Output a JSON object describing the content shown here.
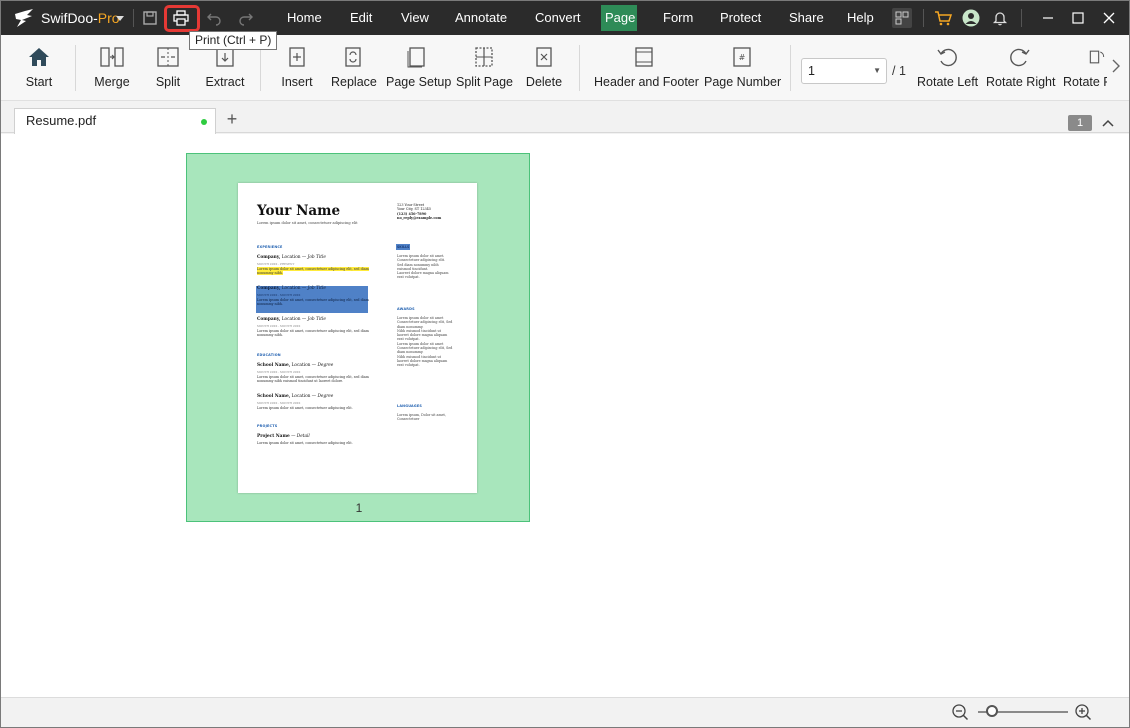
{
  "app": {
    "name_main": "SwifDoo-",
    "name_pro": "Pro"
  },
  "menu": [
    "Home",
    "Edit",
    "View",
    "Annotate",
    "Convert",
    "Page",
    "Form",
    "Protect",
    "Share",
    "Help"
  ],
  "active_menu": "Page",
  "tooltip": "Print (Ctrl + P)",
  "ribbon": {
    "start": "Start",
    "merge": "Merge",
    "split": "Split",
    "extract": "Extract",
    "insert": "Insert",
    "replace": "Replace",
    "page_setup": "Page Setup",
    "split_page": "Split Page",
    "delete": "Delete",
    "header_footer": "Header and Footer",
    "page_number": "Page Number",
    "page_value": "1",
    "page_total": "/ 1",
    "rotate_left": "Rotate Left",
    "rotate_right": "Rotate Right",
    "rotate_page": "Rotate P"
  },
  "tabs": {
    "file": "Resume.pdf",
    "add": "+",
    "page_count": "1"
  },
  "thumbnail": {
    "page_label": "1"
  },
  "resume": {
    "name": "Your Name",
    "subtitle": "Lorem ipsum dolor sit amet, consectetuer adipiscing elit",
    "contact": [
      "123 Your Street",
      "Your City, ST 12345",
      "(123) 456-7890",
      "no_reply@example.com"
    ],
    "sections": {
      "experience": "EXPERIENCE",
      "education": "EDUCATION",
      "projects": "PROJECTS",
      "skills": "SKILLS",
      "awards": "AWARDS",
      "languages": "LANGUAGES"
    },
    "jobs": [
      {
        "company": "Company,",
        "rest": " Location — ",
        "title": "Job Title",
        "meta": "MONTH 20XX - PRESENT",
        "desc": "Lorem ipsum dolor sit amet, consectetuer adipiscing elit, sed diam nonummy nibh."
      },
      {
        "company": "Company,",
        "rest": " Location — ",
        "title": "Job Title",
        "meta": "MONTH 20XX - MONTH 20XX",
        "desc": "Lorem ipsum dolor sit amet, consectetuer adipiscing elit, sed diam nonummy nibh."
      },
      {
        "company": "Company,",
        "rest": " Location — ",
        "title": "Job Title",
        "meta": "MONTH 20XX - MONTH 20XX",
        "desc": "Lorem ipsum dolor sit amet, consectetuer adipiscing elit, sed diam nonummy nibh."
      }
    ],
    "schools": [
      {
        "school": "School Name,",
        "rest": " Location — ",
        "degree": "Degree",
        "meta": "MONTH 20XX - MONTH 20XX",
        "desc": "Lorem ipsum dolor sit amet, consectetuer adipiscing elit, sed diam nonummy nibh euismod tincidunt ut laoreet dolore."
      },
      {
        "school": "School Name,",
        "rest": " Location — ",
        "degree": "Degree",
        "meta": "MONTH 20XX - MONTH 20XX",
        "desc": "Lorem ipsum dolor sit amet, consectetuer adipiscing elit."
      }
    ],
    "project": {
      "name": "Project Name",
      "rest": " — ",
      "detail": "Detail",
      "desc": "Lorem ipsum dolor sit amet, consectetuer adipiscing elit."
    },
    "skills_desc": [
      "Lorem ipsum dolor sit amet.",
      "Consectetuer adipiscing elit.",
      "Sed diam nonummy nibh euismod tincidunt.",
      "Laoreet dolore magna aliquam erat volutpat."
    ],
    "awards_desc": [
      "Lorem ipsum dolor sit amet Consectetuer adipiscing elit, Sed diam nonummy.",
      "Nibh euismod tincidunt ut laoreet dolore magna aliquam erat volutpat.",
      "Lorem ipsum dolor sit amet Consectetuer adipiscing elit, Sed diam nonummy.",
      "Nibh euismod tincidunt ut laoreet dolore magna aliquam erat volutpat."
    ],
    "languages_desc": "Lorem ipsum, Dolor sit amet, Consectetuer"
  },
  "colors": {
    "titlebar": "#2b2b2b",
    "active_menu": "#2e8b57",
    "brand_pro": "#f5a623",
    "highlight": "#e53935",
    "thumb_bg": "#a8e6bc"
  }
}
